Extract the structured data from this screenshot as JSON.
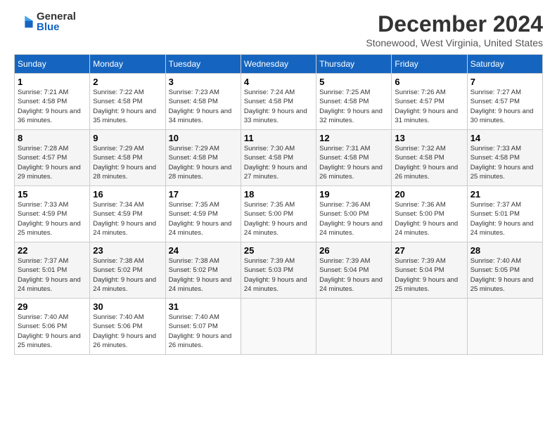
{
  "header": {
    "logo_general": "General",
    "logo_blue": "Blue",
    "month_title": "December 2024",
    "location": "Stonewood, West Virginia, United States"
  },
  "days_of_week": [
    "Sunday",
    "Monday",
    "Tuesday",
    "Wednesday",
    "Thursday",
    "Friday",
    "Saturday"
  ],
  "weeks": [
    [
      {
        "day": "1",
        "sunrise": "7:21 AM",
        "sunset": "4:58 PM",
        "daylight": "9 hours and 36 minutes."
      },
      {
        "day": "2",
        "sunrise": "7:22 AM",
        "sunset": "4:58 PM",
        "daylight": "9 hours and 35 minutes."
      },
      {
        "day": "3",
        "sunrise": "7:23 AM",
        "sunset": "4:58 PM",
        "daylight": "9 hours and 34 minutes."
      },
      {
        "day": "4",
        "sunrise": "7:24 AM",
        "sunset": "4:58 PM",
        "daylight": "9 hours and 33 minutes."
      },
      {
        "day": "5",
        "sunrise": "7:25 AM",
        "sunset": "4:58 PM",
        "daylight": "9 hours and 32 minutes."
      },
      {
        "day": "6",
        "sunrise": "7:26 AM",
        "sunset": "4:57 PM",
        "daylight": "9 hours and 31 minutes."
      },
      {
        "day": "7",
        "sunrise": "7:27 AM",
        "sunset": "4:57 PM",
        "daylight": "9 hours and 30 minutes."
      }
    ],
    [
      {
        "day": "8",
        "sunrise": "7:28 AM",
        "sunset": "4:57 PM",
        "daylight": "9 hours and 29 minutes."
      },
      {
        "day": "9",
        "sunrise": "7:29 AM",
        "sunset": "4:58 PM",
        "daylight": "9 hours and 28 minutes."
      },
      {
        "day": "10",
        "sunrise": "7:29 AM",
        "sunset": "4:58 PM",
        "daylight": "9 hours and 28 minutes."
      },
      {
        "day": "11",
        "sunrise": "7:30 AM",
        "sunset": "4:58 PM",
        "daylight": "9 hours and 27 minutes."
      },
      {
        "day": "12",
        "sunrise": "7:31 AM",
        "sunset": "4:58 PM",
        "daylight": "9 hours and 26 minutes."
      },
      {
        "day": "13",
        "sunrise": "7:32 AM",
        "sunset": "4:58 PM",
        "daylight": "9 hours and 26 minutes."
      },
      {
        "day": "14",
        "sunrise": "7:33 AM",
        "sunset": "4:58 PM",
        "daylight": "9 hours and 25 minutes."
      }
    ],
    [
      {
        "day": "15",
        "sunrise": "7:33 AM",
        "sunset": "4:59 PM",
        "daylight": "9 hours and 25 minutes."
      },
      {
        "day": "16",
        "sunrise": "7:34 AM",
        "sunset": "4:59 PM",
        "daylight": "9 hours and 24 minutes."
      },
      {
        "day": "17",
        "sunrise": "7:35 AM",
        "sunset": "4:59 PM",
        "daylight": "9 hours and 24 minutes."
      },
      {
        "day": "18",
        "sunrise": "7:35 AM",
        "sunset": "5:00 PM",
        "daylight": "9 hours and 24 minutes."
      },
      {
        "day": "19",
        "sunrise": "7:36 AM",
        "sunset": "5:00 PM",
        "daylight": "9 hours and 24 minutes."
      },
      {
        "day": "20",
        "sunrise": "7:36 AM",
        "sunset": "5:00 PM",
        "daylight": "9 hours and 24 minutes."
      },
      {
        "day": "21",
        "sunrise": "7:37 AM",
        "sunset": "5:01 PM",
        "daylight": "9 hours and 24 minutes."
      }
    ],
    [
      {
        "day": "22",
        "sunrise": "7:37 AM",
        "sunset": "5:01 PM",
        "daylight": "9 hours and 24 minutes."
      },
      {
        "day": "23",
        "sunrise": "7:38 AM",
        "sunset": "5:02 PM",
        "daylight": "9 hours and 24 minutes."
      },
      {
        "day": "24",
        "sunrise": "7:38 AM",
        "sunset": "5:02 PM",
        "daylight": "9 hours and 24 minutes."
      },
      {
        "day": "25",
        "sunrise": "7:39 AM",
        "sunset": "5:03 PM",
        "daylight": "9 hours and 24 minutes."
      },
      {
        "day": "26",
        "sunrise": "7:39 AM",
        "sunset": "5:04 PM",
        "daylight": "9 hours and 24 minutes."
      },
      {
        "day": "27",
        "sunrise": "7:39 AM",
        "sunset": "5:04 PM",
        "daylight": "9 hours and 25 minutes."
      },
      {
        "day": "28",
        "sunrise": "7:40 AM",
        "sunset": "5:05 PM",
        "daylight": "9 hours and 25 minutes."
      }
    ],
    [
      {
        "day": "29",
        "sunrise": "7:40 AM",
        "sunset": "5:06 PM",
        "daylight": "9 hours and 25 minutes."
      },
      {
        "day": "30",
        "sunrise": "7:40 AM",
        "sunset": "5:06 PM",
        "daylight": "9 hours and 26 minutes."
      },
      {
        "day": "31",
        "sunrise": "7:40 AM",
        "sunset": "5:07 PM",
        "daylight": "9 hours and 26 minutes."
      },
      null,
      null,
      null,
      null
    ]
  ]
}
